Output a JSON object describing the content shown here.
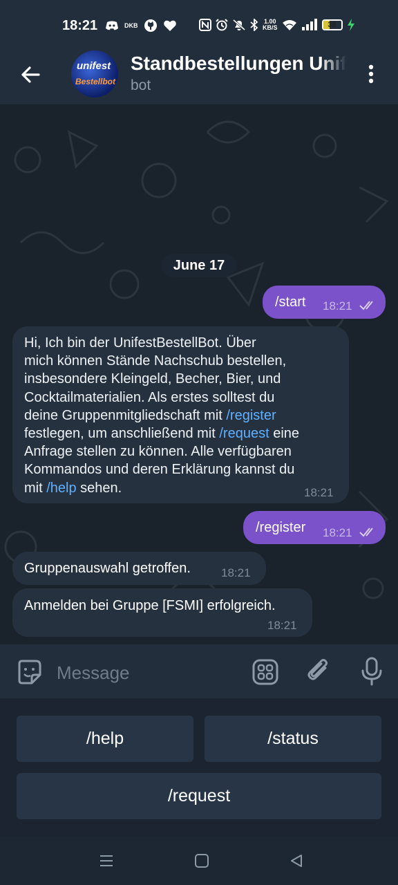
{
  "status_bar": {
    "time": "18:21",
    "small_label": "DKB",
    "net_speed_value": "1.00",
    "net_speed_unit": "KB/S",
    "battery": "38",
    "battery_level": 0.38
  },
  "header": {
    "title": "Standbestellungen Unifest",
    "subtitle": "bot",
    "avatar_text_top": "unifest",
    "avatar_text_bottom": "Bestellbot"
  },
  "chat": {
    "date_label": "June 17",
    "messages": [
      {
        "direction": "out",
        "text": "/start",
        "time": "18:21"
      },
      {
        "direction": "in",
        "lines": [
          "Hi, Ich bin der UnifestBestellBot. Über",
          "mich können Stände Nachschub bestellen,",
          "insbesondere Kleingeld, Becher, Bier, und",
          "Cocktailmaterialien. Als erstes solltest du"
        ],
        "line5_pre": "deine Gruppenmitgliedschaft mit ",
        "line5_link": "/register",
        "line6_pre": "festlegen, um anschließend mit ",
        "line6_link": "/request",
        "line6_post": " eine",
        "line7": "Anfrage stellen zu können. Alle verfügbaren",
        "line8": "Kommandos und deren Erklärung kannst du",
        "line9_pre": "mit ",
        "line9_link": "/help",
        "line9_post": " sehen.",
        "time": "18:21"
      },
      {
        "direction": "out",
        "text": "/register",
        "time": "18:21"
      },
      {
        "direction": "in",
        "text": "Gruppenauswahl getroffen.",
        "time": "18:21"
      },
      {
        "direction": "in",
        "text": "Anmelden bei Gruppe [FSMI] erfolgreich.",
        "time": "18:21"
      }
    ]
  },
  "composer": {
    "placeholder": "Message"
  },
  "keyboard": {
    "buttons": [
      "/help",
      "/status",
      "/request"
    ]
  },
  "icons": {
    "back": "arrow-left-icon",
    "menu": "more-vertical-icon",
    "emoji": "sticker-icon",
    "bot_commands": "grid-icon",
    "attach": "paperclip-icon",
    "mic": "microphone-icon"
  },
  "colors": {
    "outgoing_bubble": "#7b52c9",
    "incoming_bubble": "#263140",
    "link": "#5fb1ff",
    "header_bg": "#222e3c"
  }
}
